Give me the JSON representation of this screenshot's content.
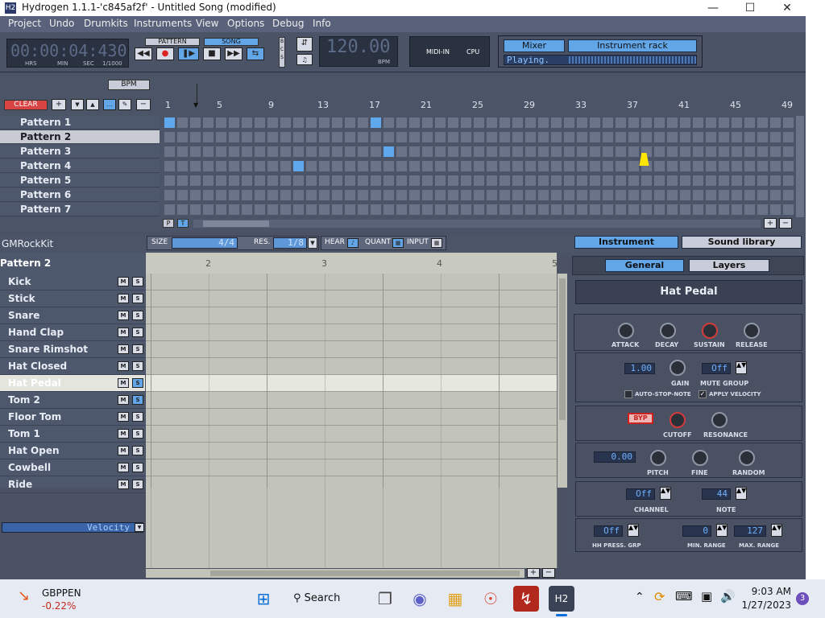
{
  "window": {
    "title": "Hydrogen 1.1.1-'c845af2f' - Untitled Song (modified)",
    "app_icon": "H2"
  },
  "menu": [
    "Project",
    "Undo",
    "Drumkits",
    "Instruments",
    "View",
    "Options",
    "Debug",
    "Info"
  ],
  "transport": {
    "time": "00:00:04:430",
    "time_labels": [
      "HRS",
      "MIN",
      "SEC",
      "1/1000"
    ],
    "mode_pattern": "PATTERN",
    "mode_song": "SONG",
    "bpm": "120.00",
    "bpm_label": "BPM",
    "midi_label": "MIDI-IN",
    "cpu_label": "CPU",
    "mixer": "Mixer",
    "instrument_rack": "Instrument rack",
    "status": "Playing."
  },
  "song_editor": {
    "bpm_btn": "BPM",
    "clear_btn": "CLEAR",
    "ruler": [
      "1",
      "5",
      "9",
      "13",
      "17",
      "21",
      "25",
      "29",
      "33",
      "37",
      "41",
      "45",
      "49"
    ],
    "patterns": [
      "Pattern 1",
      "Pattern 2",
      "Pattern 3",
      "Pattern 4",
      "Pattern 5",
      "Pattern 6",
      "Pattern 7"
    ],
    "active_cells": [
      [
        0,
        0
      ],
      [
        0,
        16
      ],
      [
        2,
        17
      ],
      [
        3,
        10
      ]
    ],
    "p_btn": "P",
    "t_btn": "T"
  },
  "pattern_editor": {
    "drumkit": "GMRockKit",
    "size_label": "SIZE",
    "size_value": "4/4",
    "res_label": "RES.",
    "res_value": "1/8",
    "hear_label": "HEAR",
    "quant_label": "QUANT",
    "input_label": "INPUT",
    "pattern_name": "Pattern 2",
    "beats": [
      "2",
      "3",
      "4",
      "5"
    ],
    "velocity_label": "Velocity",
    "instruments": [
      "Kick",
      "Stick",
      "Snare",
      "Hand Clap",
      "Snare Rimshot",
      "Hat Closed",
      "Hat Pedal",
      "Tom 2",
      "Floor Tom",
      "Tom 1",
      "Hat Open",
      "Cowbell",
      "Ride"
    ],
    "selected_instrument": "Hat Pedal",
    "mute_label": "M",
    "solo_label": "S"
  },
  "instrument_panel": {
    "tab_instrument": "Instrument",
    "tab_sound_library": "Sound library",
    "tab_general": "General",
    "tab_layers": "Layers",
    "name": "Hat Pedal",
    "env_labels": [
      "ATTACK",
      "DECAY",
      "SUSTAIN",
      "RELEASE"
    ],
    "gain_value": "1.00",
    "gain_label": "GAIN",
    "mute_group_value": "Off",
    "mute_group_label": "MUTE GROUP",
    "auto_stop_note": "AUTO-STOP-NOTE",
    "apply_velocity": "APPLY VELOCITY",
    "byp": "BYP",
    "cutoff": "CUTOFF",
    "resonance": "RESONANCE",
    "pitch_value": "0.00",
    "pitch": "PITCH",
    "fine": "FINE",
    "random": "RANDOM",
    "channel_value": "Off",
    "channel_label": "CHANNEL",
    "note_value": "44",
    "note_label": "NOTE",
    "hh_value": "Off",
    "hh_label": "HH PRESS. GRP",
    "min_value": "0",
    "min_label": "MIN. RANGE",
    "max_value": "127",
    "max_label": "MAX. RANGE"
  },
  "taskbar": {
    "ticker": "GBPPEN",
    "ticker_change": "-0.22%",
    "search": "Search",
    "time": "9:03 AM",
    "date": "1/27/2023",
    "notification_count": "3"
  },
  "colors": {
    "accent": "#63a6e8",
    "panel": "#4b5366",
    "editor_bg": "#c2c4ba"
  }
}
